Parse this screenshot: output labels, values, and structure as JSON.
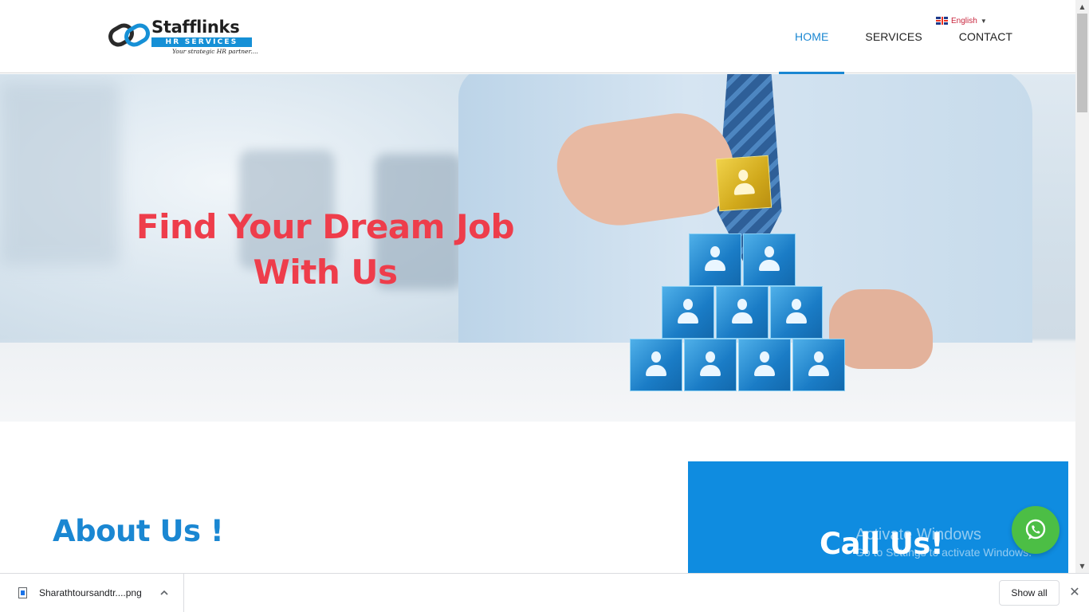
{
  "logo": {
    "name": "Stafflinks",
    "band": "HR SERVICES",
    "tagline": "Your strategic HR partner...."
  },
  "language": {
    "label": "English",
    "caret": "▼"
  },
  "nav": [
    {
      "label": "HOME",
      "active": true
    },
    {
      "label": "SERVICES",
      "active": false
    },
    {
      "label": "CONTACT",
      "active": false
    }
  ],
  "hero": {
    "title_line1": "Find Your Dream Job",
    "title_line2": "With Us"
  },
  "about": {
    "title": "About Us !"
  },
  "call": {
    "title": "Call Us!"
  },
  "windows_watermark": {
    "line1": "Activate Windows",
    "line2": "Go to Settings to activate Windows."
  },
  "download_bar": {
    "file_name": "Sharathtoursandtr....png",
    "show_all": "Show all",
    "close": "✕"
  },
  "colors": {
    "brand_blue": "#1a87d2",
    "hero_red": "#ee3d4b",
    "call_box": "#0f8ce0",
    "whatsapp_green": "#4cbe45"
  },
  "icons": [
    "flag-uk-icon",
    "whatsapp-icon",
    "file-icon",
    "chevron-up-icon",
    "close-icon"
  ]
}
